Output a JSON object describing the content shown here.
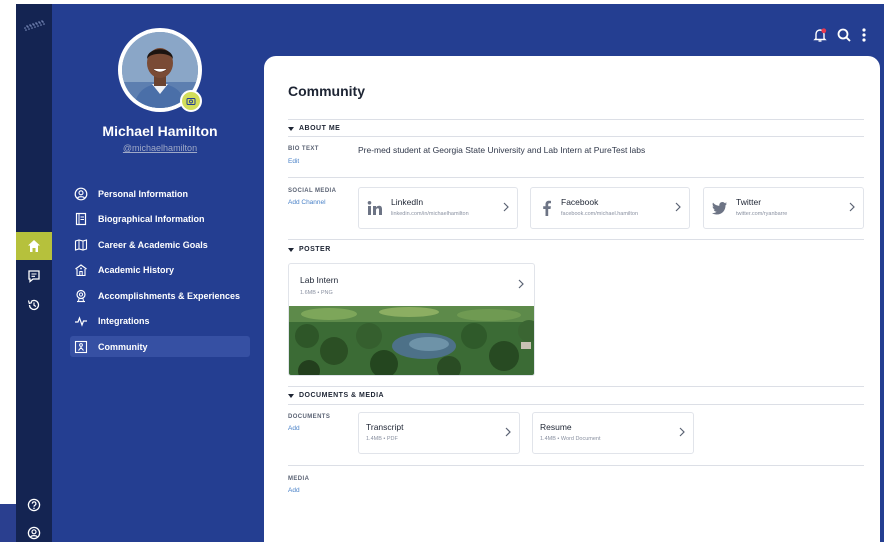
{
  "user": {
    "name": "Michael Hamilton",
    "handle": "@michaelhamilton"
  },
  "nav": [
    {
      "label": "Personal Information",
      "icon": "user-circle-icon"
    },
    {
      "label": "Biographical Information",
      "icon": "document-icon"
    },
    {
      "label": "Career & Academic Goals",
      "icon": "map-icon"
    },
    {
      "label": "Academic History",
      "icon": "school-icon"
    },
    {
      "label": "Accomplishments & Experiences",
      "icon": "award-icon"
    },
    {
      "label": "Integrations",
      "icon": "pulse-icon"
    },
    {
      "label": "Community",
      "icon": "community-icon",
      "selected": true
    }
  ],
  "page": {
    "title": "Community",
    "about": {
      "heading": "ABOUT ME",
      "bio_label": "BIO TEXT",
      "bio_edit": "Edit",
      "bio_text": "Pre-med student at Georgia State University and Lab Intern at PureTest labs",
      "social_label": "SOCIAL MEDIA",
      "social_add": "Add Channel",
      "channels": [
        {
          "name": "LinkedIn",
          "url": "linkedin.com/in/michaelhamilton",
          "icon": "linkedin-icon"
        },
        {
          "name": "Facebook",
          "url": "facebook.com/michael.hamilton",
          "icon": "facebook-icon"
        },
        {
          "name": "Twitter",
          "url": "twitter.com/ryanbarre",
          "icon": "twitter-icon"
        }
      ]
    },
    "poster": {
      "heading": "POSTER",
      "title": "Lab Intern",
      "meta": "1.6MB • PNG"
    },
    "docs": {
      "heading": "DOCUMENTS & MEDIA",
      "documents_label": "DOCUMENTS",
      "documents_add": "Add",
      "files": [
        {
          "name": "Transcript",
          "meta": "1.4MB • PDF"
        },
        {
          "name": "Resume",
          "meta": "1.4MB • Word Document"
        }
      ],
      "media_label": "MEDIA",
      "media_add": "Add"
    }
  },
  "colors": {
    "rail": "#142452",
    "profile_panel": "#243e91",
    "accent": "#b6c13c",
    "link": "#4a82c8"
  }
}
